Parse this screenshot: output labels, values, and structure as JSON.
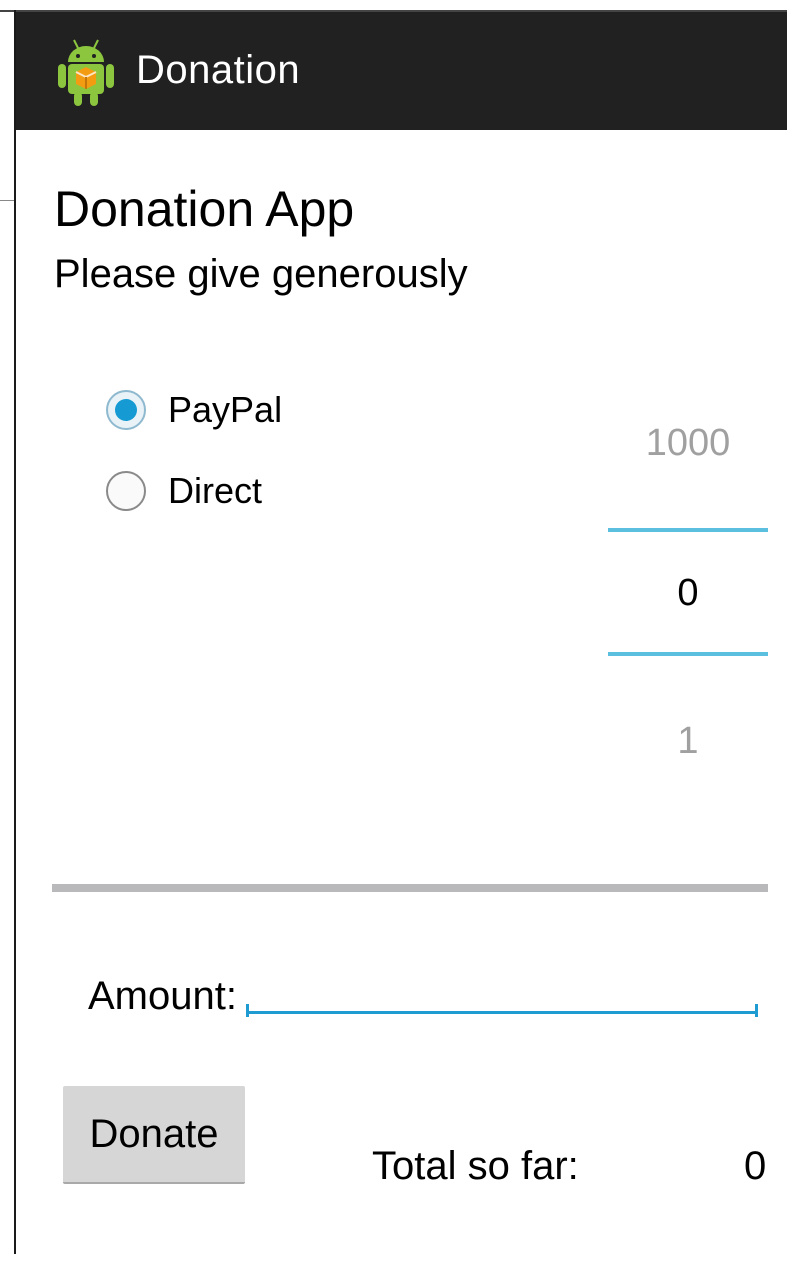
{
  "action_bar": {
    "title": "Donation",
    "icon": "android-icon"
  },
  "header": {
    "title": "Donation App",
    "subtitle": "Please give generously"
  },
  "payment": {
    "options": [
      {
        "label": "PayPal",
        "checked": true
      },
      {
        "label": "Direct",
        "checked": false
      }
    ]
  },
  "picker": {
    "previous": "1000",
    "current": "0",
    "next": "1"
  },
  "progress": {
    "value": 0
  },
  "amount": {
    "label": "Amount:",
    "value": ""
  },
  "donate_button": {
    "label": "Donate"
  },
  "total": {
    "label": "Total so far:",
    "value": "0"
  },
  "colors": {
    "accent": "#1e9bd1",
    "action_bar": "#212121",
    "picker_line": "#5bc0e0"
  }
}
